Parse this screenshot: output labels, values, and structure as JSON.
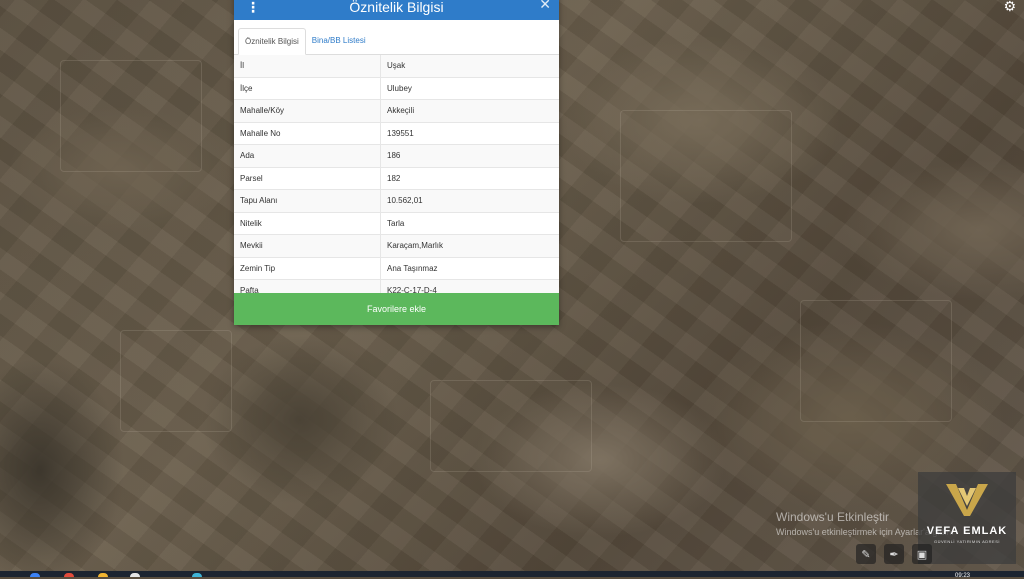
{
  "panel": {
    "title": "Öznitelik Bilgisi",
    "tabs": [
      {
        "label": "Öznitelik Bilgisi",
        "active": true
      },
      {
        "label": "Bina/BB Listesi",
        "active": false
      }
    ],
    "rows": [
      {
        "key": "İl",
        "value": "Uşak"
      },
      {
        "key": "İlçe",
        "value": "Ulubey"
      },
      {
        "key": "Mahalle/Köy",
        "value": "Akkeçili"
      },
      {
        "key": "Mahalle No",
        "value": "139551"
      },
      {
        "key": "Ada",
        "value": "186"
      },
      {
        "key": "Parsel",
        "value": "182"
      },
      {
        "key": "Tapu Alanı",
        "value": "10.562,01"
      },
      {
        "key": "Nitelik",
        "value": "Tarla"
      },
      {
        "key": "Mevkii",
        "value": "Karaçam,Marlık"
      },
      {
        "key": "Zemin Tip",
        "value": "Ana Taşınmaz"
      },
      {
        "key": "Pafta",
        "value": "K22-C-17-D-4"
      }
    ],
    "favorite_button": "Favorilere ekle",
    "colors": {
      "header": "#2f7cc9",
      "button": "#5cb85c"
    }
  },
  "watermark": {
    "line1": "Windows'u Etkinleştir",
    "line2": "Windows'u etkinleştirmek için Ayarlar'a gidin."
  },
  "logo": {
    "name": "VEFA EMLAK",
    "tagline": "GÜVENLİ YATIRIMIN ADRESİ"
  },
  "taskbar": {
    "clock": "09:23"
  }
}
